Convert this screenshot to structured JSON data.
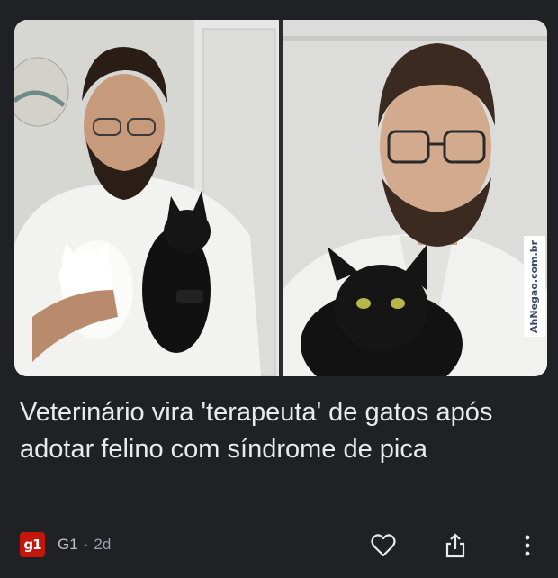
{
  "watermark": "AhNegao.com.br",
  "headline": "Veterinário vira 'terapeuta' de gatos após adotar felino com síndrome de pica",
  "source": {
    "logo_text": "g1",
    "name": "G1",
    "separator": "·",
    "age": "2d"
  },
  "icons": {
    "like": "heart-icon",
    "share": "share-icon",
    "more": "more-vertical-icon"
  },
  "colors": {
    "background": "#202124",
    "text": "#e8eaed",
    "source_brand": "#c4170c"
  }
}
